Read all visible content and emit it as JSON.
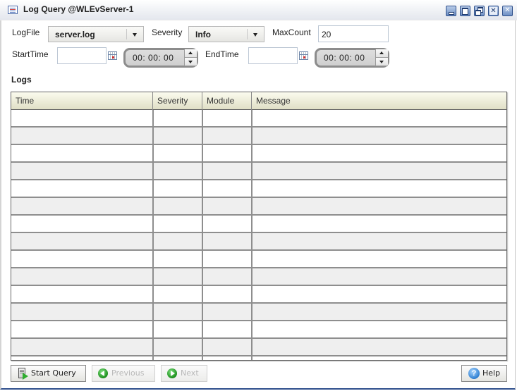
{
  "window": {
    "title": "Log Query @WLEvServer-1",
    "icon": "list-icon",
    "controls": [
      "minimize-icon",
      "maximize-icon",
      "restore-icon",
      "close-all-icon",
      "close-icon"
    ]
  },
  "form": {
    "logfile": {
      "label": "LogFile",
      "value": "server.log"
    },
    "severity": {
      "label": "Severity",
      "value": "Info"
    },
    "maxcount": {
      "label": "MaxCount",
      "value": "20"
    },
    "starttime": {
      "label": "StartTime",
      "date": "",
      "time": "00: 00: 00"
    },
    "endtime": {
      "label": "EndTime",
      "date": "",
      "time": "00: 00: 00"
    }
  },
  "logs": {
    "section_title": "Logs",
    "columns": [
      "Time",
      "Severity",
      "Module",
      "Message"
    ],
    "rows": [
      [
        "",
        "",
        "",
        ""
      ],
      [
        "",
        "",
        "",
        ""
      ],
      [
        "",
        "",
        "",
        ""
      ],
      [
        "",
        "",
        "",
        ""
      ],
      [
        "",
        "",
        "",
        ""
      ],
      [
        "",
        "",
        "",
        ""
      ],
      [
        "",
        "",
        "",
        ""
      ],
      [
        "",
        "",
        "",
        ""
      ],
      [
        "",
        "",
        "",
        ""
      ],
      [
        "",
        "",
        "",
        ""
      ],
      [
        "",
        "",
        "",
        ""
      ],
      [
        "",
        "",
        "",
        ""
      ],
      [
        "",
        "",
        "",
        ""
      ],
      [
        "",
        "",
        "",
        ""
      ],
      [
        "",
        "",
        "",
        ""
      ]
    ]
  },
  "buttons": {
    "start_query": "Start Query",
    "previous": "Previous",
    "next": "Next",
    "help": "Help",
    "help_glyph": "?"
  }
}
